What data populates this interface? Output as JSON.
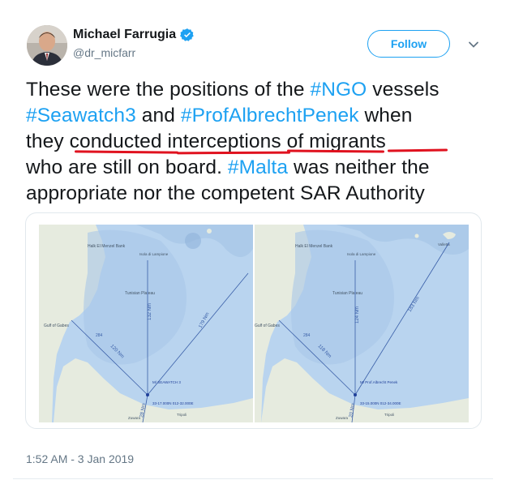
{
  "author": {
    "name": "Michael Farrugia",
    "handle": "@dr_micfarr",
    "verified": true,
    "follow_label": "Follow"
  },
  "tweet": {
    "line1": {
      "t1": "These were the positions of the ",
      "tag1": "#NGO",
      "t2": " vessels"
    },
    "line2": {
      "tag1": "#Seawatch3",
      "t1": " and ",
      "tag2": "#ProfAlbrechtPenek",
      "t2": " when"
    },
    "line3": {
      "t1": "they ",
      "u1": "conducted interceptions of migrants"
    },
    "line4": {
      "t1": "who are still on board. ",
      "tag1": "#Malta",
      "t2": " was neither the"
    },
    "line5": {
      "t1": "appropriate nor the competent SAR Authority"
    }
  },
  "media": {
    "left_map": {
      "bank_label": "Halk El Menzel Bank",
      "lampione": "Isola di Lampione",
      "plateau": "Tunisian Plateau",
      "gulf": "Gulf of Gabes",
      "vessel_label": "M/ SEAWATCH 3",
      "coords": "33-17.000N 012-32.000E",
      "dist_a": "132 Nm",
      "dist_b": "179 Nm",
      "dist_c": "120 Nm",
      "dist_d": "28 Nm",
      "dist_e": "284",
      "place1": "Tripoli",
      "place2": "Zuwara"
    },
    "right_map": {
      "bank_label": "Halk El Menzel Bank",
      "lampione": "Isola di Lampione",
      "valletta": "Valletta",
      "plateau": "Tunisian Plateau",
      "gulf": "Gulf of Gabes",
      "vessel_label": "M/ Prof.Albrecht Penek",
      "coords": "33-15.000N 012-34.000E",
      "dist_a": "124 Nm",
      "dist_b": "183 Nm",
      "dist_c": "118 Nm",
      "dist_d": "20 Nm",
      "dist_e": "284",
      "place1": "Tripoli",
      "place2": "Zuwara"
    }
  },
  "timestamp": "1:52 AM - 3 Jan 2019",
  "colors": {
    "accent": "#1da1f2",
    "text": "#14171a",
    "muted": "#657786",
    "underline": "#e0121f"
  }
}
